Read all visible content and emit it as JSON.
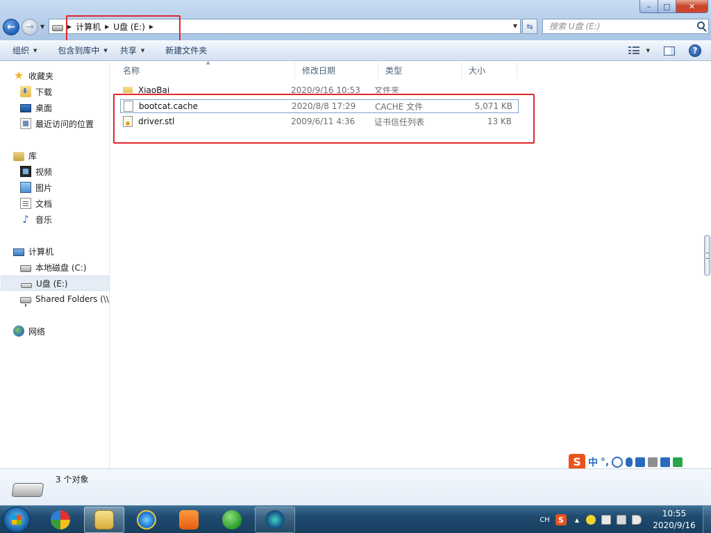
{
  "window": {
    "caption_min": "–",
    "caption_max": "□",
    "caption_close": "✕"
  },
  "nav": {
    "back_glyph": "←",
    "forward_glyph": "→"
  },
  "address": {
    "crumbs": [
      "计算机",
      "U盘 (E:)"
    ],
    "refresh_glyph": "⇆"
  },
  "search": {
    "placeholder": "搜索 U盘 (E:)"
  },
  "toolbar": {
    "organize": "组织",
    "include_library": "包含到库中",
    "share": "共享",
    "new_folder": "新建文件夹",
    "help_glyph": "?"
  },
  "sidebar": {
    "favorites": "收藏夹",
    "downloads": "下载",
    "desktop": "桌面",
    "recent": "最近访问的位置",
    "libraries": "库",
    "videos": "视频",
    "pictures": "图片",
    "documents": "文档",
    "music": "音乐",
    "computer": "计算机",
    "local_disk": "本地磁盘 (C:)",
    "usb": "U盘 (E:)",
    "shared": "Shared Folders (\\\\",
    "network": "网络"
  },
  "columns": {
    "name": "名称",
    "date": "修改日期",
    "type": "类型",
    "size": "大小"
  },
  "files": [
    {
      "name": "XiaoBai",
      "date": "2020/9/16 10:53",
      "type": "文件夹",
      "size": "",
      "icon": "folder-icon"
    },
    {
      "name": "bootcat.cache",
      "date": "2020/8/8 17:29",
      "type": "CACHE 文件",
      "size": "5,071 KB",
      "icon": "file-icon"
    },
    {
      "name": "driver.stl",
      "date": "2009/6/11 4:36",
      "type": "证书信任列表",
      "size": "13 KB",
      "icon": "certificate-icon"
    }
  ],
  "ime": {
    "logo": "S",
    "mode": "中",
    "punct": "°,"
  },
  "details": {
    "count": "3 个对象"
  },
  "taskbar": {
    "tray_lang": "CH",
    "tray_s": "S",
    "tray_up": "▲",
    "time": "10:55",
    "date": "2020/9/16"
  },
  "colors": {
    "highlight_red": "#e0262a",
    "ime_orange": "#e9541d",
    "taskbar": "#1e4a6e"
  }
}
